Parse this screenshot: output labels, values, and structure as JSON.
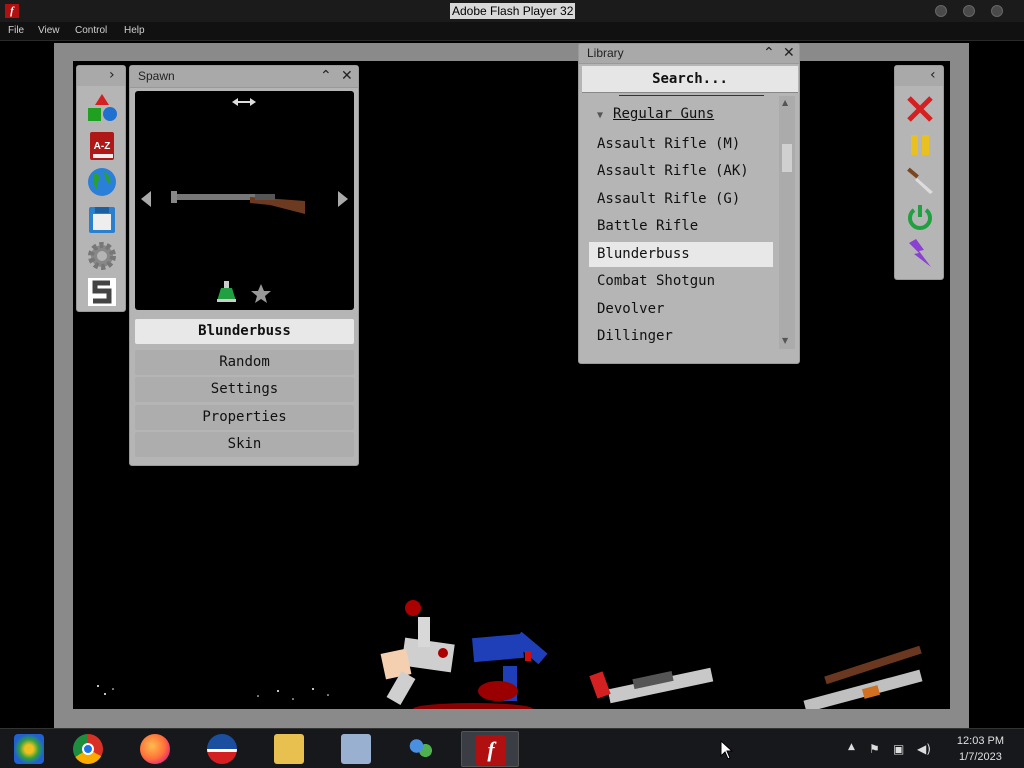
{
  "window": {
    "title": "Adobe Flash Player 32"
  },
  "menu": {
    "items": [
      "File",
      "View",
      "Control",
      "Help"
    ]
  },
  "spawn_panel": {
    "title": "Spawn",
    "selected_item": "Blunderbuss",
    "buttons": [
      "Random",
      "Settings",
      "Properties",
      "Skin"
    ]
  },
  "library_panel": {
    "title": "Library",
    "search_placeholder": "Search...",
    "category": "Regular Guns",
    "items": [
      "Assault Rifle (M)",
      "Assault Rifle (AK)",
      "Assault Rifle (G)",
      "Battle Rifle",
      "Blunderbuss",
      "Combat Shotgun",
      "Devolver",
      "Dillinger"
    ],
    "selected_index": 4
  },
  "left_toolbar": {
    "icons": [
      "shapes-icon",
      "a-z-book-icon",
      "globe-icon",
      "save-disk-icon",
      "gear-icon",
      "s-logo-icon"
    ]
  },
  "right_toolbar": {
    "icons": [
      "clear-x-icon",
      "pause-icon",
      "knife-icon",
      "power-icon",
      "lightning-icon"
    ]
  },
  "taskbar": {
    "apps": [
      "media-center-icon",
      "chrome-icon",
      "firefox-icon",
      "obama-logo-icon",
      "file-explorer-icon",
      "control-panel-icon",
      "users-icon",
      "flash-player-icon"
    ],
    "time": "12:03 PM",
    "date": "1/7/2023"
  },
  "colors": {
    "accent_red": "#d42020",
    "panel_gray": "#b5b5b5",
    "selected_bg": "#e8e8e8"
  }
}
